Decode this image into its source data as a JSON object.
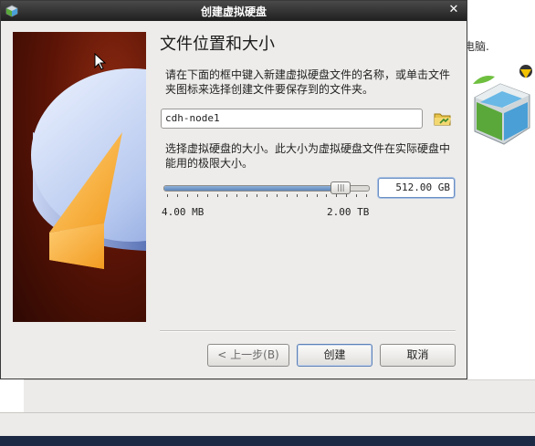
{
  "background_app": {
    "partial_text": "电脑."
  },
  "dialog": {
    "title": "创建虚拟硬盘",
    "heading": "文件位置和大小",
    "location_description": "请在下面的框中键入新建虚拟硬盘文件的名称，或单击文件夹图标来选择创建文件要保存到的文件夹。",
    "file_name_value": "cdh-node1",
    "size_description": "选择虚拟硬盘的大小。此大小为虚拟硬盘文件在实际硬盘中能用的极限大小。",
    "size_slider": {
      "min_label": "4.00 MB",
      "max_label": "2.00 TB",
      "position_fraction": 0.86
    },
    "size_value": "512.00 GB",
    "buttons": {
      "back": "< 上一步(B)",
      "create": "创建",
      "cancel": "取消"
    }
  },
  "icons": {
    "window_icon": "virtualbox-icon",
    "close": "close-icon",
    "folder": "folder-browse-icon"
  }
}
